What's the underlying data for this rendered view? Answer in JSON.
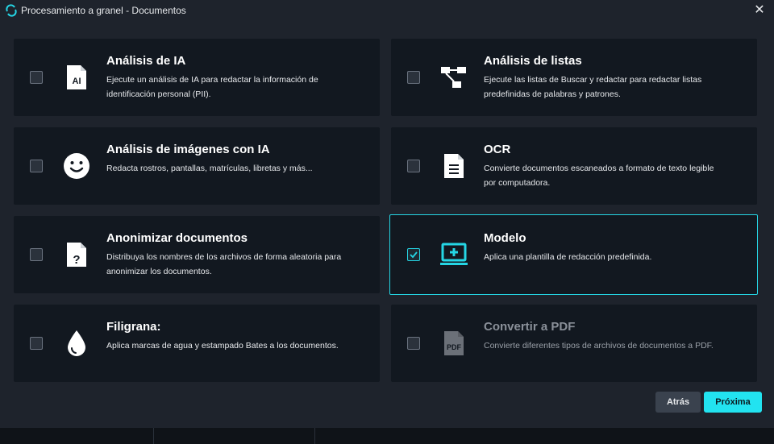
{
  "window": {
    "title": "Procesamiento a granel - Documentos"
  },
  "cards": [
    {
      "title": "Análisis de IA",
      "description": "Ejecute un análisis de IA para redactar la información de identificación personal (PII).",
      "checked": false,
      "icon": "ai-document-icon",
      "icon_text": "AI"
    },
    {
      "title": "Análisis de listas",
      "description": "Ejecute las listas de Buscar y redactar para redactar listas predefinidas de palabras y patrones.",
      "checked": false,
      "icon": "flow-diagram-icon"
    },
    {
      "title": "Análisis de imágenes con IA",
      "description": "Redacta rostros, pantallas, matrículas, libretas y más...",
      "checked": false,
      "icon": "smiley-face-icon"
    },
    {
      "title": "OCR",
      "description": "Convierte documentos escaneados a formato de texto legible por computadora.",
      "checked": false,
      "icon": "text-document-icon"
    },
    {
      "title": "Anonimizar documentos",
      "description": "Distribuya los nombres de los archivos de forma aleatoria para anonimizar los documentos.",
      "checked": false,
      "icon": "question-document-icon",
      "icon_text": "?"
    },
    {
      "title": "Modelo",
      "description": "Aplica una plantilla de redacción predefinida.",
      "checked": true,
      "icon": "laptop-plus-icon"
    },
    {
      "title": "Filigrana:",
      "description": "Aplica marcas de agua y estampado Bates a los documentos.",
      "checked": false,
      "icon": "water-drop-icon"
    },
    {
      "title": "Convertir a PDF",
      "description": "Convierte diferentes tipos de archivos de documentos a PDF.",
      "checked": false,
      "icon": "pdf-document-icon",
      "icon_text": "PDF",
      "disabled": true
    }
  ],
  "buttons": {
    "back": "Atrás",
    "next": "Próxima"
  },
  "colors": {
    "accent": "#22e3f0",
    "card_bg": "#121820",
    "window_bg": "#1e232c"
  }
}
